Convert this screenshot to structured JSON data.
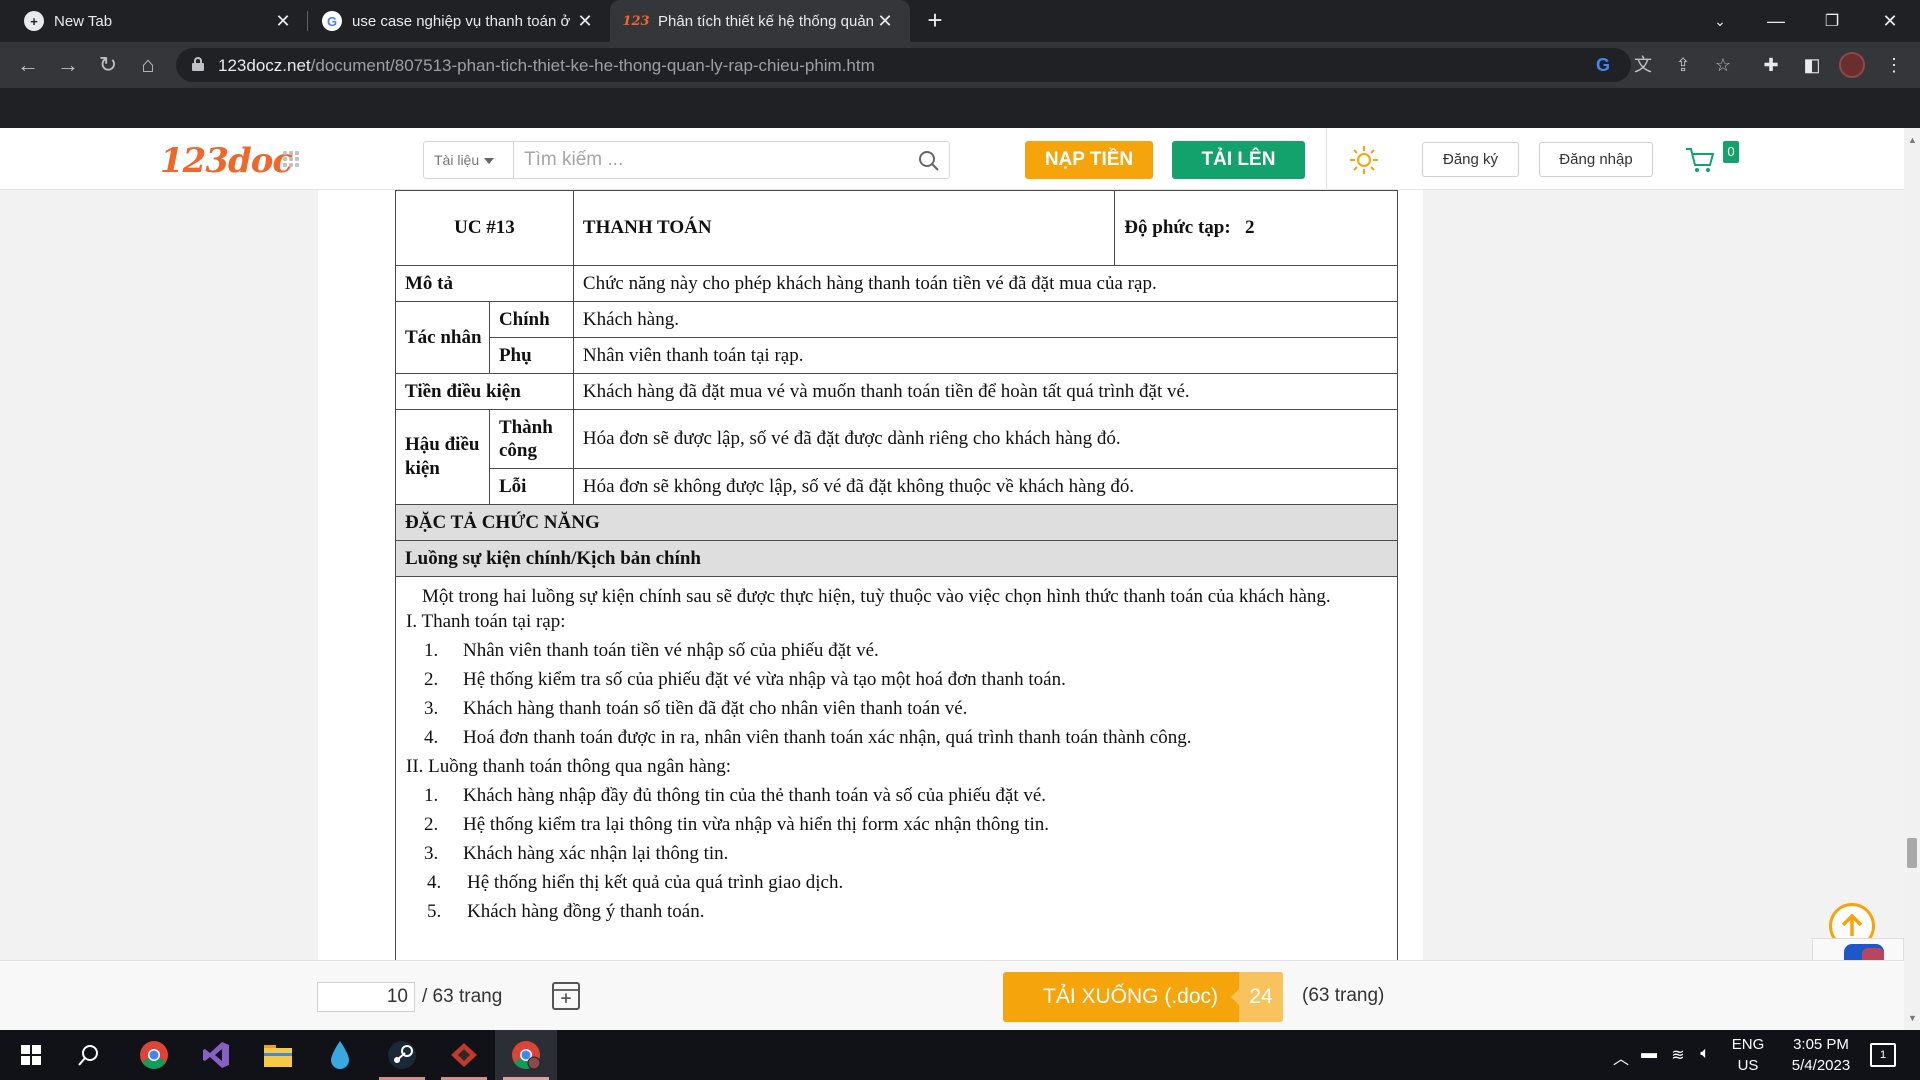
{
  "browser": {
    "tabs": [
      {
        "title": "New Tab",
        "icon": "chrome-plus-icon"
      },
      {
        "title": "use case nghiệp vụ thanh toán ở rạp",
        "icon": "google-g-icon"
      },
      {
        "title": "Phân tích thiết kế hệ thống quản lý",
        "icon": "123doc-favicon"
      }
    ],
    "url_host": "123docz.net",
    "url_path": "/document/807513-phan-tich-thiet-ke-he-thong-quan-ly-rap-chieu-phim.htm"
  },
  "site": {
    "logo_text": "123doc",
    "category_select": "Tài liệu",
    "search_placeholder": "Tìm kiếm ...",
    "nap_tien": "NẠP TIỀN",
    "tai_len": "TẢI LÊN",
    "dang_ky": "Đăng ký",
    "dang_nhap": "Đăng nhập",
    "cart_count": "0",
    "colors": {
      "brand": "#f0672b",
      "orange": "#f5a40c",
      "green": "#13a16c"
    }
  },
  "document": {
    "uc_id": "UC #13",
    "uc_name": "THANH TOÁN",
    "complexity_label": "Độ phức tạp:",
    "complexity_value": "2",
    "mo_ta_label": "Mô tả",
    "mo_ta": "Chức năng này cho phép khách hàng thanh toán tiền vé đã đặt mua của rạp.",
    "tac_nhan_label": "Tác nhân",
    "chinh_label": "Chính",
    "chinh": "Khách hàng.",
    "phu_label": "Phụ",
    "phu": "Nhân viên thanh toán tại rạp.",
    "tien_dieu_kien_label": "Tiền điều kiện",
    "tien_dieu_kien": "Khách hàng đã đặt mua vé và muốn thanh toán tiền để hoàn tất quá trình đặt vé.",
    "hau_dieu_kien_label": "Hậu điều kiện",
    "thanh_cong_label": "Thành công",
    "thanh_cong": "Hóa đơn sẽ được lập, số vé đã đặt được dành riêng cho khách hàng đó.",
    "loi_label": "Lỗi",
    "loi": "Hóa đơn sẽ không được lập, số vé đã đặt không thuộc về khách hàng đó.",
    "dac_ta_label": "ĐẶC TẢ CHỨC NĂNG",
    "luong_label": "Luồng sự kiện chính/Kịch bản chính",
    "intro": "Một trong hai luồng sự kiện chính sau sẽ được thực hiện, tuỳ thuộc vào việc chọn hình thức thanh toán của khách hàng.",
    "section1": "I.  Thanh toán tại rạp:",
    "section1_items": [
      {
        "n": "1.",
        "text": "Nhân viên thanh toán tiền vé nhập số của phiếu đặt vé."
      },
      {
        "n": "2.",
        "text": "Hệ thống kiểm tra số của phiếu đặt vé vừa nhập và tạo một hoá đơn thanh toán."
      },
      {
        "n": "3.",
        "text": "Khách hàng thanh toán số tiền đã đặt cho nhân viên thanh toán vé."
      },
      {
        "n": "4.",
        "text": "Hoá đơn thanh toán được in ra, nhân viên thanh toán xác nhận, quá trình thanh toán thành công."
      }
    ],
    "section2": "II.  Luồng thanh toán thông qua ngân hàng:",
    "section2_items": [
      {
        "n": "1.",
        "text": "Khách hàng nhập đầy đủ thông tin của thẻ thanh toán và số của phiếu đặt vé."
      },
      {
        "n": "2.",
        "text": "Hệ thống kiểm tra lại thông tin vừa nhập và hiển thị form xác nhận thông tin."
      },
      {
        "n": "3.",
        "text": "Khách hàng xác nhận lại thông tin."
      },
      {
        "n": "4.",
        "text": "Hệ thống hiển thị kết quả của quá trình giao dịch."
      },
      {
        "n": "5.",
        "text": "Khách hàng đồng ý thanh toán."
      }
    ]
  },
  "download": {
    "current_page": "10",
    "page_total": "/ 63 trang",
    "button_label": "TẢI XUỐNG (.doc)",
    "button_count": "24",
    "pages_label": "(63 trang)"
  },
  "taskbar": {
    "lang_top": "ENG",
    "lang_bottom": "US",
    "time": "3:05 PM",
    "date": "5/4/2023",
    "notif_count": "1"
  }
}
